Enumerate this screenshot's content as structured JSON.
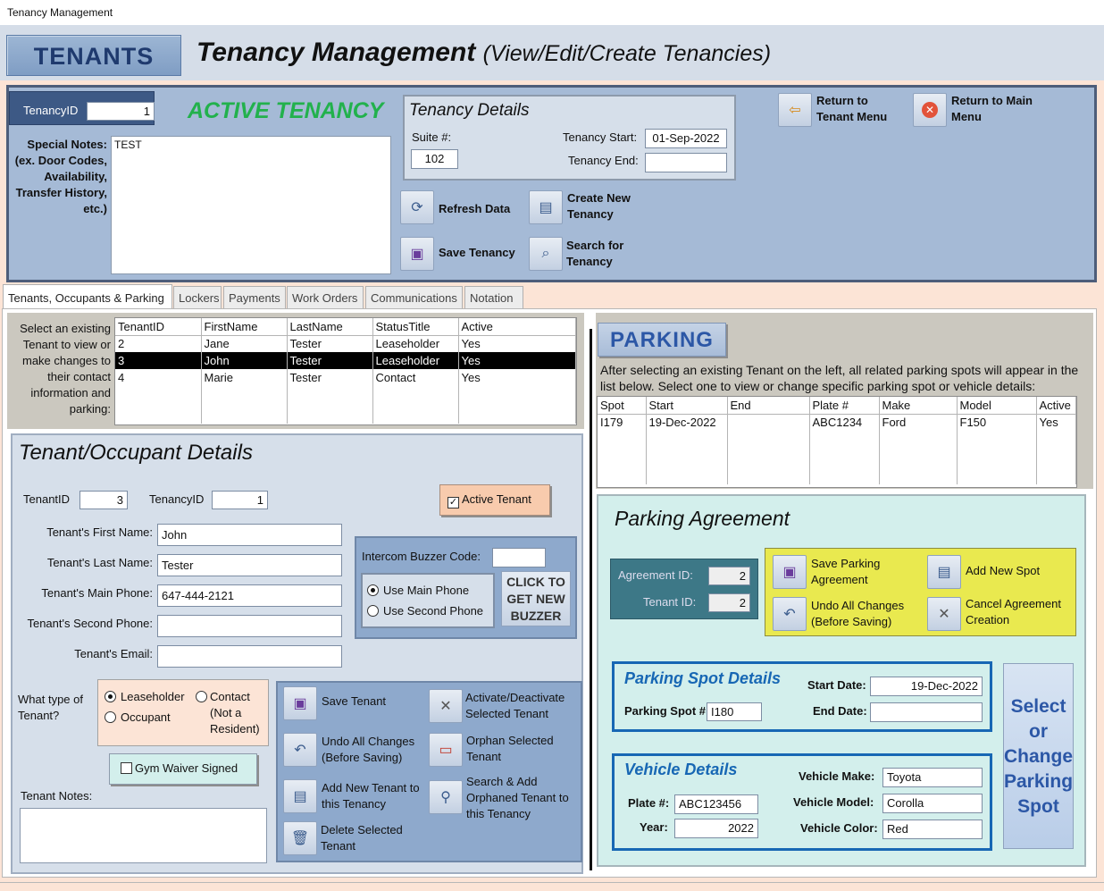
{
  "window": {
    "title": "Tenancy Management"
  },
  "header": {
    "badge": "TENANTS",
    "title": "Tenancy Management",
    "subtitle": "(View/Edit/Create Tenancies)"
  },
  "tenancy": {
    "id_label": "TenancyID",
    "id_value": "1",
    "status": "ACTIVE TENANCY",
    "notes_label": "Special Notes: (ex. Door Codes, Availability, Transfer History, etc.)",
    "notes_value": "TEST",
    "details_title": "Tenancy Details",
    "suite_label": "Suite #:",
    "suite_value": "102",
    "start_label": "Tenancy Start:",
    "start_value": "01-Sep-2022",
    "end_label": "Tenancy End:",
    "end_value": ""
  },
  "top_buttons": {
    "refresh": "Refresh Data",
    "save": "Save Tenancy",
    "create": "Create New Tenancy",
    "search": "Search for Tenancy",
    "return_tenant": "Return to Tenant Menu",
    "return_main": "Return to Main Menu"
  },
  "tabs": [
    "Tenants, Occupants & Parking",
    "Lockers",
    "Payments",
    "Work Orders",
    "Communications",
    "Notation"
  ],
  "tenant_select": {
    "label": "Select an existing Tenant to view or make changes to their contact information and parking:",
    "columns": [
      "TenantID",
      "FirstName",
      "LastName",
      "StatusTitle",
      "Active"
    ],
    "rows": [
      [
        "2",
        "Jane",
        "Tester",
        "Leaseholder",
        "Yes"
      ],
      [
        "3",
        "John",
        "Tester",
        "Leaseholder",
        "Yes"
      ],
      [
        "4",
        "Marie",
        "Tester",
        "Contact",
        "Yes"
      ]
    ],
    "selected_row": 1
  },
  "tenant_details": {
    "title": "Tenant/Occupant Details",
    "tenant_id_label": "TenantID",
    "tenant_id": "3",
    "tenancy_id_label": "TenancyID",
    "tenancy_id": "1",
    "active_label": "Active Tenant",
    "active_checked": true,
    "first_label": "Tenant's First Name:",
    "first": "John",
    "last_label": "Tenant's Last Name:",
    "last": "Tester",
    "main_phone_label": "Tenant's Main Phone:",
    "main_phone": "647-444-2121",
    "second_phone_label": "Tenant's Second Phone:",
    "second_phone": "",
    "email_label": "Tenant's Email:",
    "email": "",
    "intercom_label": "Intercom Buzzer Code:",
    "intercom": "",
    "use_main": "Use Main Phone",
    "use_second": "Use Second Phone",
    "buzzer_button": "CLICK TO GET NEW BUZZER",
    "type_label": "What type of Tenant?",
    "type_leaseholder": "Leaseholder",
    "type_occupant": "Occupant",
    "type_contact": "Contact (Not a Resident)",
    "gym_label": "Gym Waiver Signed",
    "gym_checked": false,
    "notes_label": "Tenant Notes:"
  },
  "tenant_buttons": {
    "save": "Save Tenant",
    "undo": "Undo All Changes (Before Saving)",
    "add": "Add New Tenant to this Tenancy",
    "delete": "Delete Selected Tenant",
    "activate": "Activate/Deactivate Selected Tenant",
    "orphan": "Orphan Selected Tenant",
    "search_add": "Search & Add Orphaned Tenant to this Tenancy"
  },
  "parking": {
    "title": "PARKING",
    "desc": "After selecting an existing Tenant on the left, all related parking spots will appear in the list below. Select one to view or change specific parking spot or vehicle details:",
    "columns": [
      "Spot",
      "Start",
      "End",
      "Plate #",
      "Make",
      "Model",
      "Active"
    ],
    "rows": [
      [
        "I179",
        "19-Dec-2022",
        "",
        "ABC1234",
        "Ford",
        "F150",
        "Yes"
      ]
    ]
  },
  "agreement": {
    "title": "Parking Agreement",
    "agreement_id_label": "Agreement ID:",
    "agreement_id": "2",
    "tenant_id_label": "Tenant ID:",
    "tenant_id": "2",
    "save": "Save Parking Agreement",
    "undo": "Undo All Changes (Before Saving)",
    "add_spot": "Add New Spot",
    "cancel": "Cancel Agreement Creation",
    "spot_title": "Parking Spot Details",
    "spot_label": "Parking Spot #:",
    "spot": "I180",
    "start_label": "Start Date:",
    "start": "19-Dec-2022",
    "end_label": "End Date:",
    "end": "",
    "vehicle_title": "Vehicle Details",
    "plate_label": "Plate #:",
    "plate": "ABC123456",
    "year_label": "Year:",
    "year": "2022",
    "make_label": "Vehicle Make:",
    "make": "Toyota",
    "model_label": "Vehicle Model:",
    "model": "Corolla",
    "color_label": "Vehicle Color:",
    "color": "Red",
    "select_change": "Select or Change Parking Spot"
  }
}
